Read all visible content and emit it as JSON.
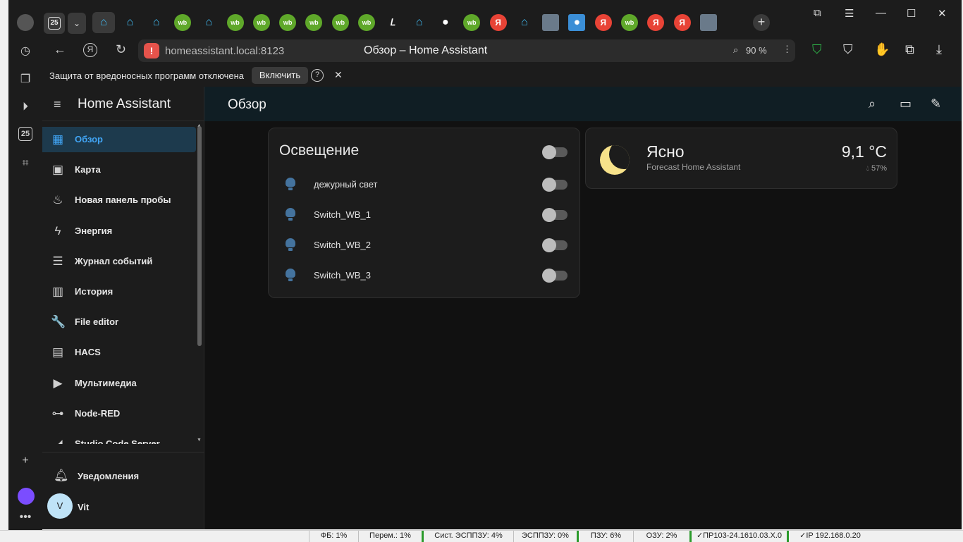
{
  "browser": {
    "tab_count_badge": "25",
    "tabs": [
      {
        "kind": "ha",
        "icon": "home-assistant-icon",
        "active": true
      },
      {
        "kind": "ha",
        "icon": "home-assistant-icon"
      },
      {
        "kind": "ha",
        "icon": "home-assistant-icon"
      },
      {
        "kind": "wb",
        "icon": "wb-icon",
        "label": "wb"
      },
      {
        "kind": "ha",
        "icon": "home-assistant-icon"
      },
      {
        "kind": "wb",
        "icon": "wb-icon",
        "label": "wb"
      },
      {
        "kind": "wb",
        "icon": "wb-icon",
        "label": "wb"
      },
      {
        "kind": "wb",
        "icon": "wb-icon",
        "label": "wb"
      },
      {
        "kind": "wb",
        "icon": "wb-icon",
        "label": "wb"
      },
      {
        "kind": "wb",
        "icon": "wb-icon",
        "label": "wb"
      },
      {
        "kind": "wb",
        "icon": "wb-icon",
        "label": "wb"
      },
      {
        "kind": "dark",
        "icon": "typography-icon",
        "label": "𝐿"
      },
      {
        "kind": "ha",
        "icon": "home-assistant-icon"
      },
      {
        "kind": "gh",
        "icon": "github-icon"
      },
      {
        "kind": "wb",
        "icon": "wb-icon",
        "label": "wb"
      },
      {
        "kind": "ya",
        "icon": "yandex-icon",
        "label": "Я"
      },
      {
        "kind": "ha",
        "icon": "home-assistant-icon"
      },
      {
        "kind": "img",
        "icon": "house-picture-icon"
      },
      {
        "kind": "blue",
        "icon": "snowflake-icon"
      },
      {
        "kind": "ya",
        "icon": "yandex-icon",
        "label": "Я"
      },
      {
        "kind": "wb",
        "icon": "wb-icon",
        "label": "wb"
      },
      {
        "kind": "ya",
        "icon": "yandex-icon",
        "label": "Я"
      },
      {
        "kind": "ya",
        "icon": "yandex-icon",
        "label": "Я"
      },
      {
        "kind": "img",
        "icon": "avatar-picture-icon"
      }
    ],
    "url": "homeassistant.local:8123",
    "page_title": "Обзор – Home Assistant",
    "zoom": "90 %",
    "protection_text": "Защита от вредоносных программ отключена",
    "protection_button": "Включить",
    "protection_help": "?",
    "protection_close": "✕"
  },
  "sidebar": {
    "title": "Home Assistant",
    "items": [
      {
        "label": "Обзор",
        "icon": "dashboard-icon",
        "glyph": "▦",
        "selected": true
      },
      {
        "label": "Карта",
        "icon": "map-account-icon",
        "glyph": "▣"
      },
      {
        "label": "Новая панель пробы",
        "icon": "wb-panel-icon",
        "glyph": "♨"
      },
      {
        "label": "Энергия",
        "icon": "lightning-icon",
        "glyph": "ϟ"
      },
      {
        "label": "Журнал событий",
        "icon": "format-list-icon",
        "glyph": "☰"
      },
      {
        "label": "История",
        "icon": "chart-box-icon",
        "glyph": "▥"
      },
      {
        "label": "File editor",
        "icon": "wrench-icon",
        "glyph": "🔧"
      },
      {
        "label": "HACS",
        "icon": "hacs-icon",
        "glyph": "▤"
      },
      {
        "label": "Мультимедиа",
        "icon": "play-box-icon",
        "glyph": "▶"
      },
      {
        "label": "Node-RED",
        "icon": "sitemap-icon",
        "glyph": "⊶"
      },
      {
        "label": "Studio Code Server",
        "icon": "vscode-icon",
        "glyph": "◢"
      }
    ],
    "notifications_label": "Уведомления",
    "user_name": "Vit",
    "user_initial": "V"
  },
  "header": {
    "title": "Обзор"
  },
  "lighting_card": {
    "title": "Освещение",
    "rows": [
      {
        "name": "дежурный свет",
        "on": false
      },
      {
        "name": "Switch_WB_1",
        "on": false
      },
      {
        "name": "Switch_WB_2",
        "on": false
      },
      {
        "name": "Switch_WB_3",
        "on": false
      }
    ]
  },
  "weather_card": {
    "state": "Ясно",
    "source": "Forecast Home Assistant",
    "temperature": "9,1 °C",
    "humidity": "57%"
  },
  "statusbar": [
    {
      "text": "ФБ: 1%"
    },
    {
      "text": "Перем.: 1%"
    },
    {
      "text": "Сист. ЭСППЗУ: 4%",
      "green": true
    },
    {
      "text": "ЭСППЗУ: 0%"
    },
    {
      "text": "ПЗУ: 6%",
      "green": true
    },
    {
      "text": "ОЗУ: 2%"
    },
    {
      "text": "✓ПР103-24.1610.03.Х.0",
      "green": true
    },
    {
      "text": "✓IP 192.168.0.20",
      "green": true
    }
  ],
  "colors": {
    "accent": "#41a5f5",
    "topbar": "#101e24",
    "light_icon": "#44739e",
    "moon": "#f7e28a"
  }
}
